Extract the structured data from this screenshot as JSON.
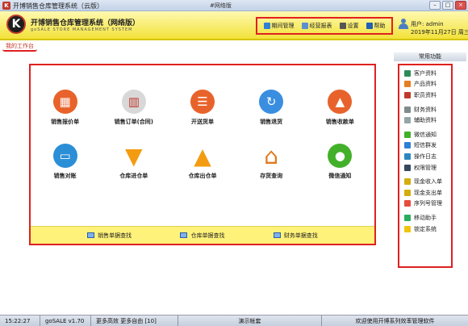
{
  "window": {
    "title": "开博销售仓库管理系统（云版）",
    "subtitle": "#网络版"
  },
  "header": {
    "app_title": "开博销售仓库管理系统（网络版）",
    "app_subtitle": "goSALE STORE MANAGEMENT SYSTEM",
    "logo_letter": "K",
    "menu": [
      {
        "label": "期间管理",
        "icon": "folder-icon",
        "color": "#2f7fd6"
      },
      {
        "label": "经营报表",
        "icon": "report-icon",
        "color": "#5a8fd0"
      },
      {
        "label": "设置",
        "icon": "settings-icon",
        "color": "#555555"
      },
      {
        "label": "帮助",
        "icon": "help-icon",
        "color": "#1f5fb5"
      }
    ],
    "user": "用户: admin",
    "date": "2019年11月27日 周三"
  },
  "tab": {
    "label": "我的工作台"
  },
  "main": {
    "tiles": [
      {
        "label": "销售报价单",
        "icon": "calculator-icon",
        "color": "#e8632b"
      },
      {
        "label": "销售订单(合同)",
        "icon": "book-icon",
        "color": "#d8d8d8"
      },
      {
        "label": "开送货单",
        "icon": "clipboard-icon",
        "color": "#e8632b"
      },
      {
        "label": "销售退货",
        "icon": "refresh-icon",
        "color": "#3a8ee0"
      },
      {
        "label": "销售收款单",
        "icon": "bell-icon",
        "color": "#e8632b"
      },
      {
        "label": "销售对账",
        "icon": "laptop-icon",
        "color": "#2a8fd6"
      },
      {
        "label": "仓库进仓单",
        "icon": "down-arrow-icon",
        "color": "#f39c12"
      },
      {
        "label": "仓库出仓单",
        "icon": "up-arrow-icon",
        "color": "#f39c12"
      },
      {
        "label": "存货查询",
        "icon": "house-icon",
        "color": "#e07a20"
      },
      {
        "label": "微信通知",
        "icon": "wechat-icon",
        "color": "#43b02a"
      }
    ],
    "quick_links": [
      "销售单据查找",
      "仓库单据查找",
      "财务单据查找"
    ]
  },
  "sidebar": {
    "heading": "常用功能",
    "groups": [
      [
        {
          "label": "客户资料",
          "icon": "customer-icon",
          "color": "#2e8b57"
        },
        {
          "label": "产品资料",
          "icon": "product-icon",
          "color": "#e67e22"
        },
        {
          "label": "职员资料",
          "icon": "staff-icon",
          "color": "#c0392b"
        }
      ],
      [
        {
          "label": "财务资料",
          "icon": "finance-icon",
          "color": "#7f8c8d"
        },
        {
          "label": "辅助资料",
          "icon": "aux-icon",
          "color": "#95a5a6"
        }
      ],
      [
        {
          "label": "微信通知",
          "icon": "wechat-icon",
          "color": "#43b02a"
        },
        {
          "label": "短信群发",
          "icon": "sms-icon",
          "color": "#2f7fd6"
        },
        {
          "label": "操作日志",
          "icon": "log-icon",
          "color": "#2e86c1"
        },
        {
          "label": "权限管理",
          "icon": "permission-icon",
          "color": "#34495e"
        }
      ],
      [
        {
          "label": "现金收入单",
          "icon": "cash-in-icon",
          "color": "#d4ac0d"
        },
        {
          "label": "现金支出单",
          "icon": "cash-out-icon",
          "color": "#d4ac0d"
        },
        {
          "label": "序列号管理",
          "icon": "serial-icon",
          "color": "#e74c3c"
        }
      ],
      [
        {
          "label": "移动助手",
          "icon": "mobile-icon",
          "color": "#27ae60"
        },
        {
          "label": "锁定系统",
          "icon": "lock-icon",
          "color": "#f1c40f"
        }
      ]
    ]
  },
  "statusbar": {
    "time": "15:22:27",
    "version": "goSALE v1.70",
    "more": "更多高效 更多自由 [10]",
    "account": "演示帐套",
    "welcome": "欢迎使用开博系列效率管理软件"
  }
}
